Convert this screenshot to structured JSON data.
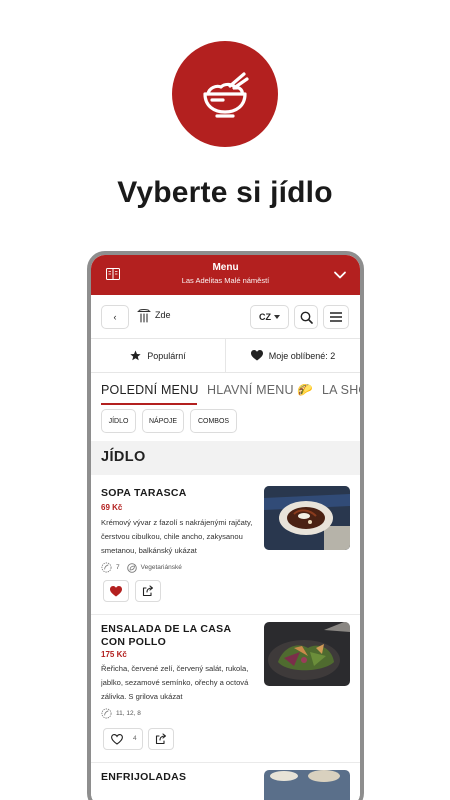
{
  "hero": {
    "icon": "rice-bowl-icon",
    "headline": "Vyberte si jídlo",
    "accent": "#b3201f"
  },
  "topbar": {
    "title": "Menu",
    "subtitle": "Las Adelitas Malé náměstí"
  },
  "toolbar": {
    "back_label": "‹",
    "location_label": "Zde",
    "language": "CZ"
  },
  "favorites": {
    "popular_label": "Populární",
    "my_favorites_label": "Moje oblíbené: 2"
  },
  "tabs": [
    {
      "label": "POLEDNÍ MENU"
    },
    {
      "label": "HLAVNÍ MENU 🌮"
    },
    {
      "label": "LA SHO"
    }
  ],
  "chips": [
    "JÍDLO",
    "NÁPOJE",
    "COMBOS"
  ],
  "section_title": "JÍDLO",
  "items": [
    {
      "name": "SOPA TARASCA",
      "price": "69 Kč",
      "description": "Krémový vývar z fazolí s nakrájenými rajčaty, čerstvou cibulkou, chile ancho, zakysanou smetanou, balkánský ukázat",
      "allergens": "7",
      "tag": "Vegetariánské",
      "liked": true,
      "likes": ""
    },
    {
      "name": "ENSALADA DE LA CASA CON POLLO",
      "price": "175 Kč",
      "description": "Řeřicha, červené zelí, červený salát, rukola, jablko, sezamové semínko, ořechy a octová zálivka. S grilova ukázat",
      "allergens": "11, 12, 8",
      "tag": "",
      "liked": false,
      "likes": "4"
    },
    {
      "name": "ENFRIJOLADAS",
      "price": "",
      "description": "",
      "allergens": "",
      "tag": "",
      "liked": false,
      "likes": ""
    }
  ]
}
